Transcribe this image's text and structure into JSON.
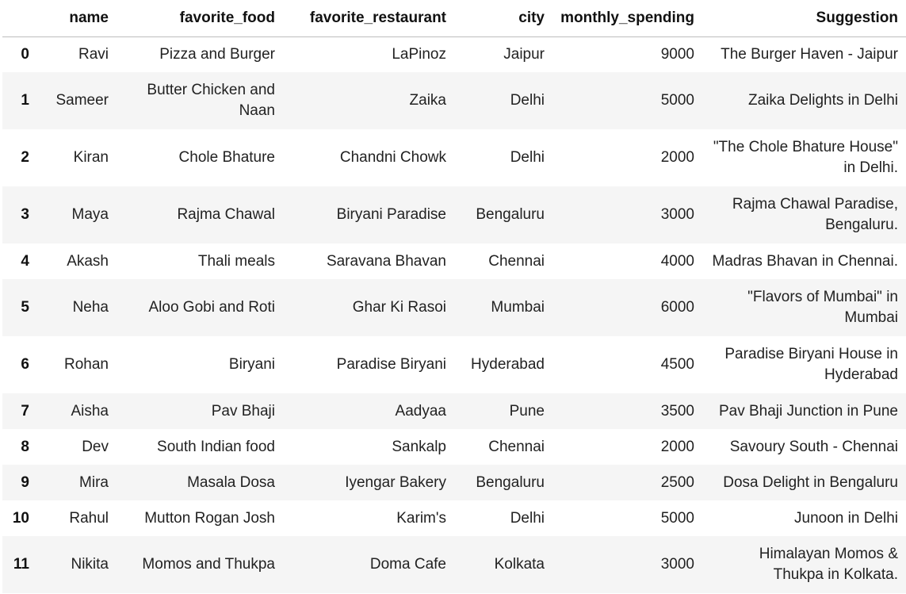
{
  "table": {
    "columns": [
      "",
      "name",
      "favorite_food",
      "favorite_restaurant",
      "city",
      "monthly_spending",
      "Suggestion"
    ],
    "rows": [
      {
        "index": "0",
        "name": "Ravi",
        "favorite_food": "Pizza and Burger",
        "favorite_restaurant": "LaPinoz",
        "city": "Jaipur",
        "monthly_spending": "9000",
        "suggestion": "The Burger Haven - Jaipur"
      },
      {
        "index": "1",
        "name": "Sameer",
        "favorite_food": "Butter Chicken and Naan",
        "favorite_restaurant": "Zaika",
        "city": "Delhi",
        "monthly_spending": "5000",
        "suggestion": "Zaika Delights in Delhi"
      },
      {
        "index": "2",
        "name": "Kiran",
        "favorite_food": "Chole Bhature",
        "favorite_restaurant": "Chandni Chowk",
        "city": "Delhi",
        "monthly_spending": "2000",
        "suggestion": "\"The Chole Bhature House\" in Delhi."
      },
      {
        "index": "3",
        "name": "Maya",
        "favorite_food": "Rajma Chawal",
        "favorite_restaurant": "Biryani Paradise",
        "city": "Bengaluru",
        "monthly_spending": "3000",
        "suggestion": "Rajma Chawal Paradise, Bengaluru."
      },
      {
        "index": "4",
        "name": "Akash",
        "favorite_food": "Thali meals",
        "favorite_restaurant": "Saravana Bhavan",
        "city": "Chennai",
        "monthly_spending": "4000",
        "suggestion": "Madras Bhavan in Chennai."
      },
      {
        "index": "5",
        "name": "Neha",
        "favorite_food": "Aloo Gobi and Roti",
        "favorite_restaurant": "Ghar Ki Rasoi",
        "city": "Mumbai",
        "monthly_spending": "6000",
        "suggestion": "\"Flavors of Mumbai\" in Mumbai"
      },
      {
        "index": "6",
        "name": "Rohan",
        "favorite_food": "Biryani",
        "favorite_restaurant": "Paradise Biryani",
        "city": "Hyderabad",
        "monthly_spending": "4500",
        "suggestion": "Paradise Biryani House in Hyderabad"
      },
      {
        "index": "7",
        "name": "Aisha",
        "favorite_food": "Pav Bhaji",
        "favorite_restaurant": "Aadyaa",
        "city": "Pune",
        "monthly_spending": "3500",
        "suggestion": "Pav Bhaji Junction in Pune"
      },
      {
        "index": "8",
        "name": "Dev",
        "favorite_food": "South Indian food",
        "favorite_restaurant": "Sankalp",
        "city": "Chennai",
        "monthly_spending": "2000",
        "suggestion": "Savoury South - Chennai"
      },
      {
        "index": "9",
        "name": "Mira",
        "favorite_food": "Masala Dosa",
        "favorite_restaurant": "Iyengar Bakery",
        "city": "Bengaluru",
        "monthly_spending": "2500",
        "suggestion": "Dosa Delight in Bengaluru"
      },
      {
        "index": "10",
        "name": "Rahul",
        "favorite_food": "Mutton Rogan Josh",
        "favorite_restaurant": "Karim's",
        "city": "Delhi",
        "monthly_spending": "5000",
        "suggestion": "Junoon in Delhi"
      },
      {
        "index": "11",
        "name": "Nikita",
        "favorite_food": "Momos and Thukpa",
        "favorite_restaurant": "Doma Cafe",
        "city": "Kolkata",
        "monthly_spending": "3000",
        "suggestion": "Himalayan Momos & Thukpa in Kolkata."
      }
    ]
  }
}
